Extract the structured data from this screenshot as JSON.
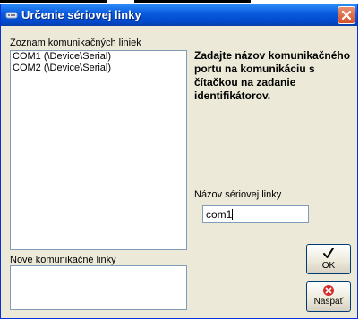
{
  "window": {
    "title": "Určenie sériovej linky",
    "title_icon": "serial-port-icon",
    "close_icon": "close-icon"
  },
  "lists": {
    "available_label": "Zoznam komunikačných liniek",
    "available_items": [
      "COM1 (\\Device\\Serial)",
      "COM2 (\\Device\\Serial)"
    ],
    "new_label": "Nové komunikačné linky",
    "new_items": []
  },
  "instruction": "Zadajte názov komunikačného portu na komunikáciu s čítačkou na zadanie identifikátorov.",
  "serial_line": {
    "label": "Názov sériovej linky",
    "value": "com1"
  },
  "buttons": {
    "ok": {
      "label": "OK",
      "icon": "checkmark-icon"
    },
    "back": {
      "label": "Naspäť",
      "icon": "cancel-icon",
      "icon_color": "#d42a2a"
    }
  },
  "colors": {
    "title_bar": "#0047c8",
    "dialog_bg": "#ece9d8",
    "close_button": "#d4512a",
    "field_border": "#7f9db9"
  }
}
